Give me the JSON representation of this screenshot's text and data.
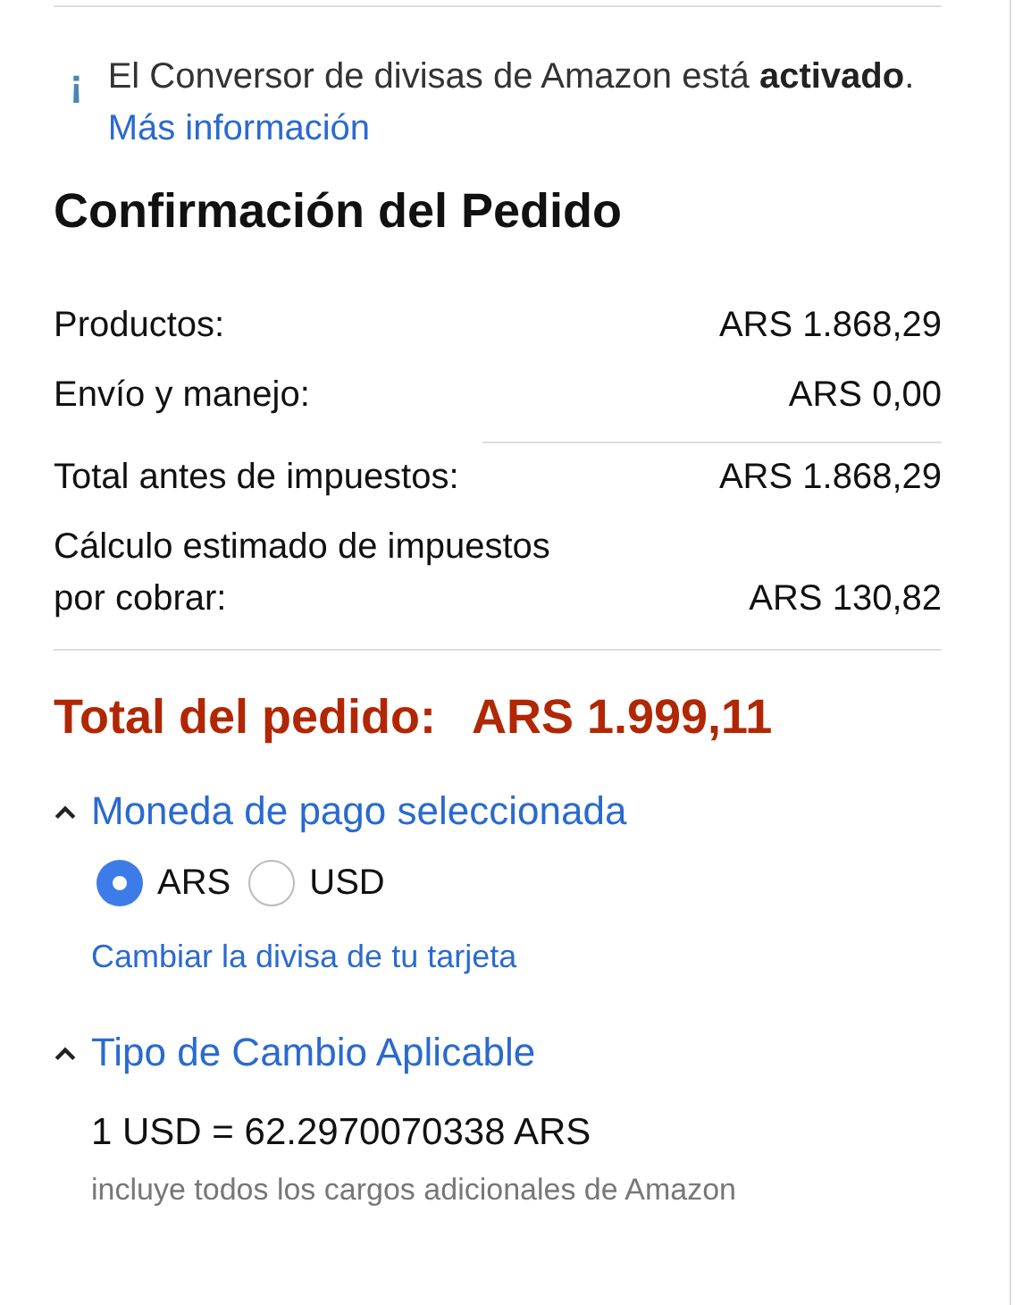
{
  "notice": {
    "icon": "¡",
    "text": "El Conversor de divisas de Amazon está **activado**.",
    "link": "Más información"
  },
  "title": "Confirmación del Pedido",
  "summary_groups": [
    [
      {
        "label": "Productos:",
        "value": "ARS 1.868,29"
      },
      {
        "label": "Envío y manejo:",
        "value": "ARS 0,00"
      }
    ],
    [
      {
        "label": "Total antes de impuestos:",
        "value": "ARS 1.868,29"
      },
      {
        "label": "Cálculo estimado de impuestos por cobrar:",
        "value": "ARS 130,82"
      }
    ]
  ],
  "total": {
    "label": "Total del pedido:",
    "value": "ARS 1.999,11"
  },
  "payment_currency": {
    "heading": "Moneda de pago seleccionada",
    "expanded": true,
    "options": [
      {
        "label": "ARS",
        "selected": true
      },
      {
        "label": "USD",
        "selected": false
      }
    ],
    "link": "Cambiar la divisa de tu tarjeta"
  },
  "exchange_rate": {
    "heading": "Tipo de Cambio Aplicable",
    "expanded": true,
    "rate": "1 USD = 62.2970070338 ARS",
    "note": "incluye todos los cargos adicionales de Amazon"
  }
}
